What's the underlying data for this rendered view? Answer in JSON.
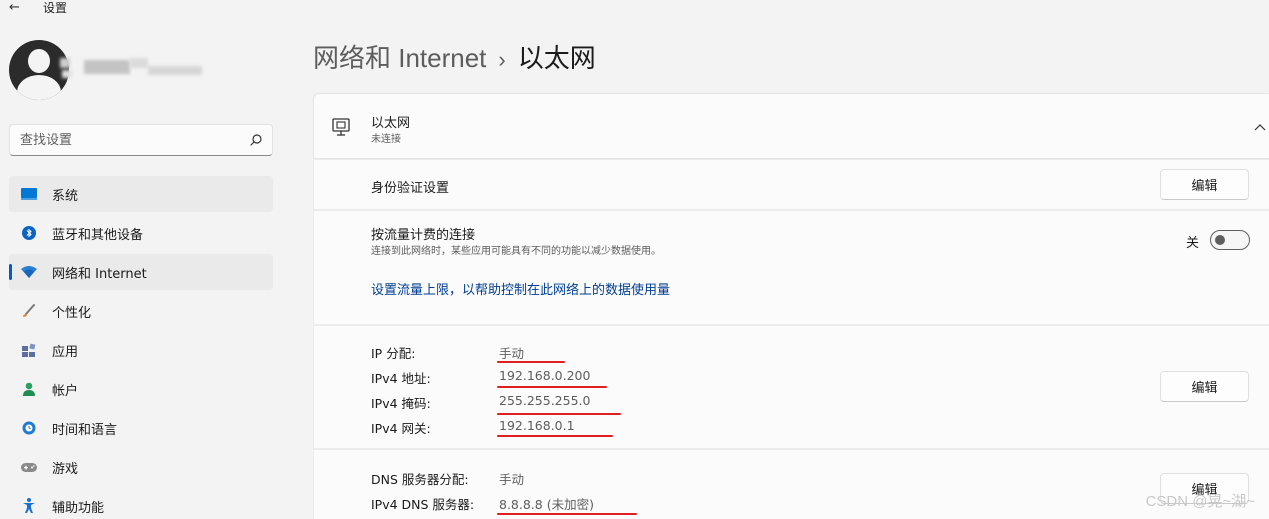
{
  "window": {
    "title": "设置"
  },
  "search": {
    "placeholder": "查找设置"
  },
  "sidebar": {
    "items": [
      {
        "label": "系统"
      },
      {
        "label": "蓝牙和其他设备"
      },
      {
        "label": "网络和 Internet"
      },
      {
        "label": "个性化"
      },
      {
        "label": "应用"
      },
      {
        "label": "帐户"
      },
      {
        "label": "时间和语言"
      },
      {
        "label": "游戏"
      },
      {
        "label": "辅助功能"
      }
    ],
    "active_index": 2
  },
  "breadcrumb": {
    "parent": "网络和 Internet",
    "separator": "›",
    "current": "以太网"
  },
  "ethernet": {
    "title": "以太网",
    "status": "未连接"
  },
  "auth": {
    "label": "身份验证设置",
    "button": "编辑"
  },
  "metered": {
    "label": "按流量计费的连接",
    "description": "连接到此网络时，某些应用可能具有不同的功能以减少数据使用。",
    "toggle_label": "关",
    "toggle_on": false,
    "link": "设置流量上限，以帮助控制在此网络上的数据使用量"
  },
  "ip": {
    "rows": [
      {
        "key": "IP 分配:",
        "value": "手动"
      },
      {
        "key": "IPv4 地址:",
        "value": "192.168.0.200"
      },
      {
        "key": "IPv4 掩码:",
        "value": "255.255.255.0"
      },
      {
        "key": "IPv4 网关:",
        "value": "192.168.0.1"
      }
    ],
    "button": "编辑"
  },
  "dns": {
    "rows": [
      {
        "key": "DNS 服务器分配:",
        "value": "手动"
      },
      {
        "key": "IPv4 DNS 服务器:",
        "value": "8.8.8.8 (未加密)"
      }
    ],
    "button": "编辑"
  },
  "watermark": "CSDN @晃~湖~",
  "colors": {
    "accent": "#005fb8",
    "link": "#003e92",
    "annotation": "#e02020",
    "background": "#f3f3f3"
  }
}
